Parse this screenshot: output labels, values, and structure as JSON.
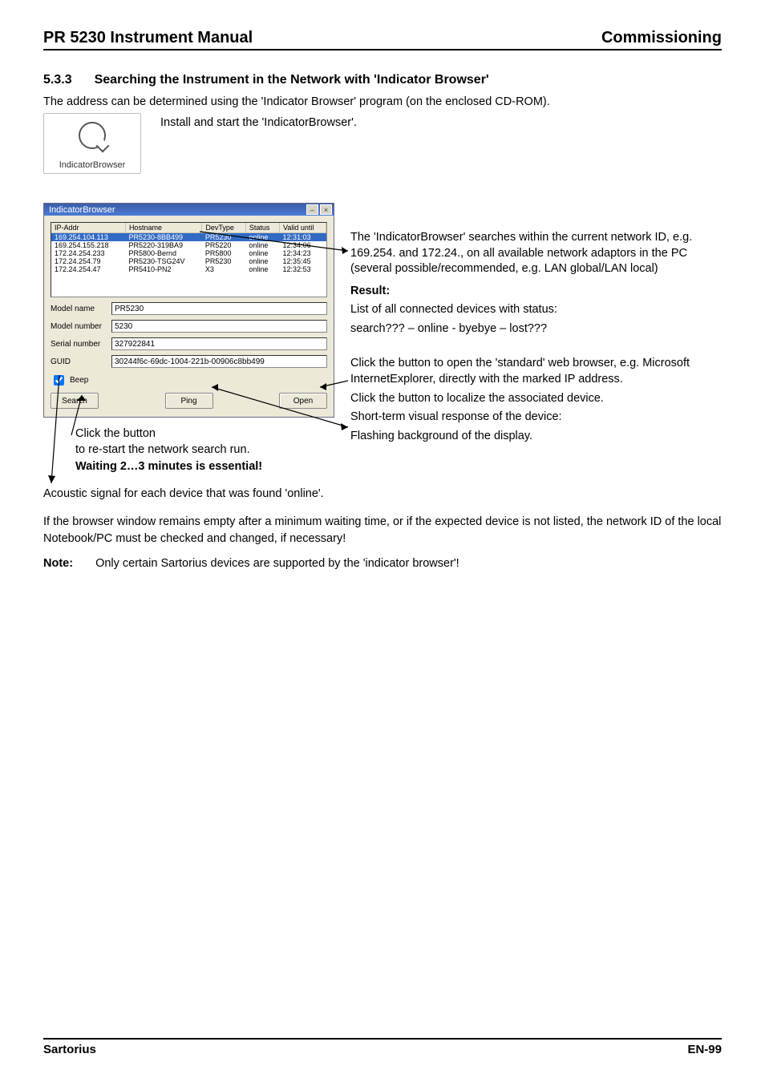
{
  "header": {
    "left": "PR 5230 Instrument Manual",
    "right": "Commissioning"
  },
  "section": {
    "number": "5.3.3",
    "title": "Searching the Instrument in the Network with 'Indicator Browser'"
  },
  "intro": "The address can be determined using the 'Indicator Browser' program (on the enclosed CD-ROM).",
  "install_line": "Install and start the 'IndicatorBrowser'.",
  "desktop_icon": {
    "label": "IndicatorBrowser"
  },
  "window": {
    "title": "IndicatorBrowser",
    "columns": [
      "IP-Addr",
      "Hostname",
      "DevType",
      "Status",
      "Valid until"
    ],
    "rows": [
      {
        "ip": "169.254.104.113",
        "host": "PR5230-8BB499",
        "type": "PR5230",
        "status": "online",
        "valid": "12:31:03",
        "selected": true
      },
      {
        "ip": "169.254.155.218",
        "host": "PR5220-319BA9",
        "type": "PR5220",
        "status": "online",
        "valid": "12:34:06"
      },
      {
        "ip": "172.24.254.233",
        "host": "PR5800-Bernd",
        "type": "PR5800",
        "status": "online",
        "valid": "12:34:23"
      },
      {
        "ip": "172.24.254.79",
        "host": "PR5230-TSG24V",
        "type": "PR5230",
        "status": "online",
        "valid": "12:35:45"
      },
      {
        "ip": "172.24.254.47",
        "host": "PR5410-PN2",
        "type": "X3",
        "status": "online",
        "valid": "12:32:53"
      }
    ],
    "fields": {
      "model_name_label": "Model name",
      "model_name": "PR5230",
      "model_number_label": "Model number",
      "model_number": "5230",
      "serial_label": "Serial number",
      "serial": "327922841",
      "guid_label": "GUID",
      "guid": "30244f6c-69dc-1004-221b-00906c8bb499",
      "beep_label": "Beep",
      "beep_checked": true
    },
    "buttons": {
      "search": "Search",
      "ping": "Ping",
      "open": "Open"
    }
  },
  "right_col": {
    "p1": "The 'IndicatorBrowser' searches within the current network ID, e.g. 169.254. and 172.24., on all available network adaptors in the PC (several possible/recommended, e.g. LAN global/LAN local)",
    "result_label": "Result:",
    "p2": "List of all connected devices with status:",
    "p3": "search??? – online - byebye – lost???",
    "p4": "Click the button to open the 'standard' web browser, e.g. Microsoft InternetExplorer, directly with the marked IP address.",
    "p5": "Click the button to localize the associated device.",
    "p6": "Short-term visual response of the device:",
    "p7": "Flashing background of the display."
  },
  "callout": {
    "l1": "Click the button",
    "l2": "to re-start the network search run.",
    "l3": "Waiting 2…3 minutes is essential!"
  },
  "after": {
    "p1": "Acoustic signal for each device that was found 'online'.",
    "p2": "If the browser window remains empty after a minimum waiting time, or if the expected device is not listed, the network ID of the local Notebook/PC must be checked and changed, if necessary!",
    "note_label": "Note:",
    "note": "Only certain Sartorius devices are supported by the 'indicator browser'!"
  },
  "footer": {
    "left": "Sartorius",
    "right": "EN-99"
  }
}
